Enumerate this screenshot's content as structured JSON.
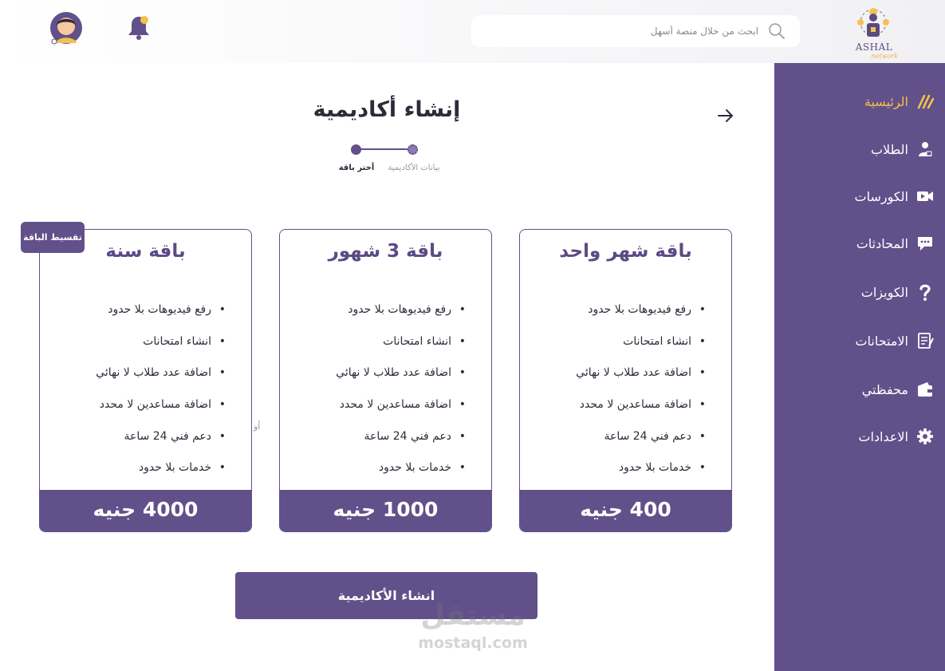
{
  "header": {
    "logo": {
      "name": "ASHAL",
      "sub": ".network"
    },
    "search": {
      "placeholder": "ابحث من خلال منصة أسهل"
    }
  },
  "sidebar": {
    "items": [
      {
        "label": "الرئيسية",
        "icon": "home-slash-icon",
        "active": true
      },
      {
        "label": "الطلاب",
        "icon": "students-icon"
      },
      {
        "label": "الكورسات",
        "icon": "video-camera-icon"
      },
      {
        "label": "المحادثات",
        "icon": "chat-icon"
      },
      {
        "label": "الكويزات",
        "icon": "question-icon"
      },
      {
        "label": "الامتحانات",
        "icon": "exam-icon"
      },
      {
        "label": "محفظتي",
        "icon": "wallet-icon"
      },
      {
        "label": "الاعدادات",
        "icon": "gear-icon"
      }
    ]
  },
  "page": {
    "title": "إنشاء أكاديمية",
    "steps": [
      {
        "label": "بيانات الأكاديمية",
        "state": "done"
      },
      {
        "label": "أختر باقة",
        "state": "current"
      }
    ]
  },
  "plans": [
    {
      "title": "باقة شهر واحد",
      "features": [
        "رفع فيديوهات بلا حدود",
        "انشاء امتحانات",
        "اضافة عدد طلاب لا نهائي",
        "اضافة مساعدين لا محدد",
        "دعم فني 24 ساعة",
        "خدمات بلا حدود"
      ],
      "price": "400 جنيه"
    },
    {
      "title": "باقة 3 شهور",
      "features": [
        "رفع فيديوهات بلا حدود",
        "انشاء امتحانات",
        "اضافة عدد طلاب لا نهائي",
        "اضافة مساعدين لا محدد",
        "دعم فني 24 ساعة",
        "خدمات بلا حدود"
      ],
      "price": "1000 جنيه"
    },
    {
      "title": "باقة سنة",
      "features": [
        "رفع فيديوهات بلا حدود",
        "انشاء امتحانات",
        "اضافة عدد طلاب لا نهائي",
        "اضافة مساعدين لا محدد",
        "دعم فني 24 ساعة",
        "خدمات بلا حدود"
      ],
      "price": "4000 جنيه",
      "badge": "تقسيط الباقة"
    }
  ],
  "or_text": "أو",
  "create_button": "انشاء الأكاديمية",
  "watermark": {
    "ar": "مستقل",
    "en": "mostaql.com"
  },
  "colors": {
    "primary": "#62508a",
    "accent": "#f3c24a",
    "title": "#5b4a85",
    "text": "#2f2a3a"
  }
}
